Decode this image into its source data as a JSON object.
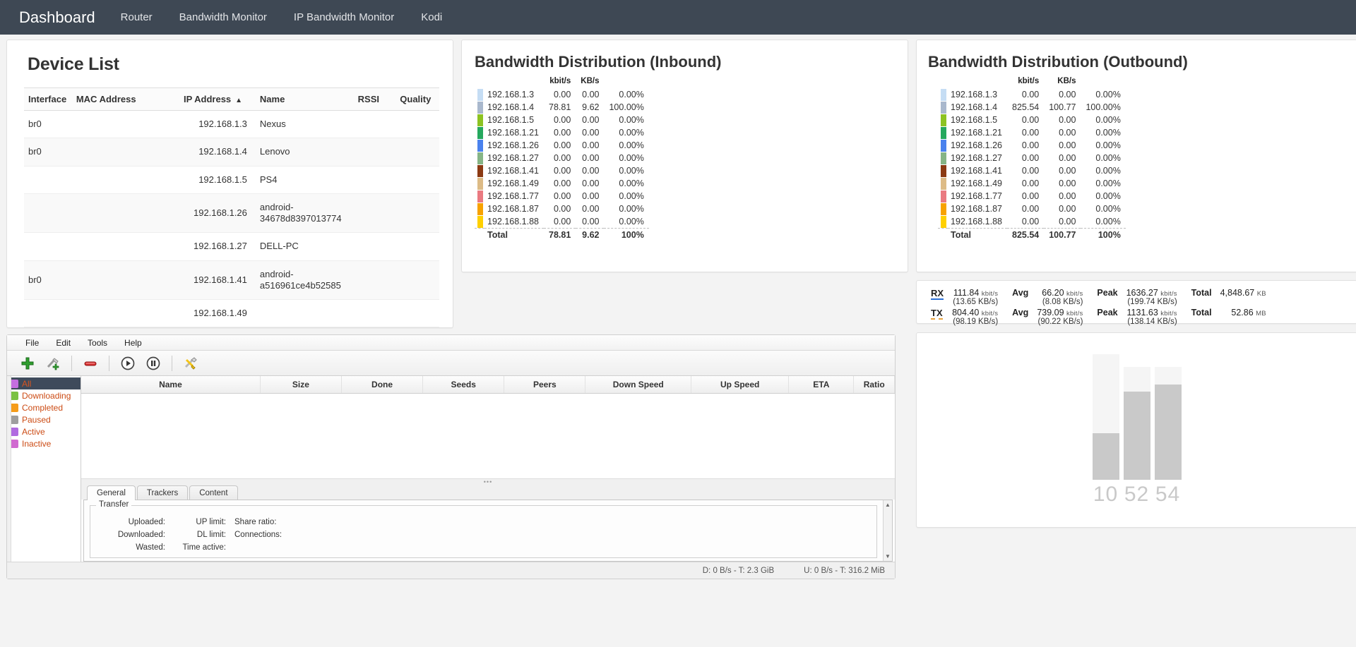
{
  "navbar": {
    "brand": "Dashboard",
    "items": [
      {
        "label": "Router"
      },
      {
        "label": "Bandwidth Monitor"
      },
      {
        "label": "IP Bandwidth Monitor"
      },
      {
        "label": "Kodi"
      }
    ]
  },
  "device_list": {
    "title": "Device List",
    "columns": [
      "Interface",
      "MAC Address",
      "IP Address",
      "Name",
      "RSSI",
      "Quality"
    ],
    "sort_column": "IP Address",
    "sort_arrow": "▲",
    "rows": [
      {
        "interface": "br0",
        "mac": "",
        "ip": "192.168.1.3",
        "name": "Nexus",
        "rssi": "",
        "quality": ""
      },
      {
        "interface": "br0",
        "mac": "",
        "ip": "192.168.1.4",
        "name": "Lenovo",
        "rssi": "",
        "quality": ""
      },
      {
        "interface": "",
        "mac": "",
        "ip": "192.168.1.5",
        "name": "PS4",
        "rssi": "",
        "quality": ""
      },
      {
        "interface": "",
        "mac": "",
        "ip": "192.168.1.26",
        "name": "android-34678d8397013774",
        "rssi": "",
        "quality": ""
      },
      {
        "interface": "",
        "mac": "",
        "ip": "192.168.1.27",
        "name": "DELL-PC",
        "rssi": "",
        "quality": ""
      },
      {
        "interface": "br0",
        "mac": "",
        "ip": "192.168.1.41",
        "name": "android-a516961ce4b52585",
        "rssi": "",
        "quality": ""
      },
      {
        "interface": "",
        "mac": "",
        "ip": "192.168.1.49",
        "name": "",
        "rssi": "",
        "quality": ""
      }
    ]
  },
  "bandwidth_inbound": {
    "title": "Bandwidth Distribution (Inbound)",
    "columns": [
      "kbit/s",
      "KB/s"
    ],
    "total_label": "Total",
    "total_kbits": "78.81",
    "total_kbytes": "9.62",
    "total_percent": "100%",
    "rows": [
      {
        "ip": "192.168.1.3",
        "color": "#c5ddf4",
        "kbits": "0.00",
        "kbytes": "0.00",
        "percent": "0.00%"
      },
      {
        "ip": "192.168.1.4",
        "color": "#a9b8cd",
        "kbits": "78.81",
        "kbytes": "9.62",
        "percent": "100.00%"
      },
      {
        "ip": "192.168.1.5",
        "color": "#8dc322",
        "kbits": "0.00",
        "kbytes": "0.00",
        "percent": "0.00%"
      },
      {
        "ip": "192.168.1.21",
        "color": "#25a85e",
        "kbits": "0.00",
        "kbytes": "0.00",
        "percent": "0.00%"
      },
      {
        "ip": "192.168.1.26",
        "color": "#4a82ee",
        "kbits": "0.00",
        "kbytes": "0.00",
        "percent": "0.00%"
      },
      {
        "ip": "192.168.1.27",
        "color": "#86b586",
        "kbits": "0.00",
        "kbytes": "0.00",
        "percent": "0.00%"
      },
      {
        "ip": "192.168.1.41",
        "color": "#8c3a13",
        "kbits": "0.00",
        "kbytes": "0.00",
        "percent": "0.00%"
      },
      {
        "ip": "192.168.1.49",
        "color": "#ddbb86",
        "kbits": "0.00",
        "kbytes": "0.00",
        "percent": "0.00%"
      },
      {
        "ip": "192.168.1.77",
        "color": "#ea7a81",
        "kbits": "0.00",
        "kbytes": "0.00",
        "percent": "0.00%"
      },
      {
        "ip": "192.168.1.87",
        "color": "#f7a200",
        "kbits": "0.00",
        "kbytes": "0.00",
        "percent": "0.00%"
      },
      {
        "ip": "192.168.1.88",
        "color": "#ffd000",
        "kbits": "0.00",
        "kbytes": "0.00",
        "percent": "0.00%"
      }
    ]
  },
  "bandwidth_outbound": {
    "title": "Bandwidth Distribution (Outbound)",
    "columns": [
      "kbit/s",
      "KB/s"
    ],
    "total_label": "Total",
    "total_kbits": "825.54",
    "total_kbytes": "100.77",
    "total_percent": "100%",
    "rows": [
      {
        "ip": "192.168.1.3",
        "color": "#c5ddf4",
        "kbits": "0.00",
        "kbytes": "0.00",
        "percent": "0.00%"
      },
      {
        "ip": "192.168.1.4",
        "color": "#a9b8cd",
        "kbits": "825.54",
        "kbytes": "100.77",
        "percent": "100.00%"
      },
      {
        "ip": "192.168.1.5",
        "color": "#8dc322",
        "kbits": "0.00",
        "kbytes": "0.00",
        "percent": "0.00%"
      },
      {
        "ip": "192.168.1.21",
        "color": "#25a85e",
        "kbits": "0.00",
        "kbytes": "0.00",
        "percent": "0.00%"
      },
      {
        "ip": "192.168.1.26",
        "color": "#4a82ee",
        "kbits": "0.00",
        "kbytes": "0.00",
        "percent": "0.00%"
      },
      {
        "ip": "192.168.1.27",
        "color": "#86b586",
        "kbits": "0.00",
        "kbytes": "0.00",
        "percent": "0.00%"
      },
      {
        "ip": "192.168.1.41",
        "color": "#8c3a13",
        "kbits": "0.00",
        "kbytes": "0.00",
        "percent": "0.00%"
      },
      {
        "ip": "192.168.1.49",
        "color": "#ddbb86",
        "kbits": "0.00",
        "kbytes": "0.00",
        "percent": "0.00%"
      },
      {
        "ip": "192.168.1.77",
        "color": "#ea7a81",
        "kbits": "0.00",
        "kbytes": "0.00",
        "percent": "0.00%"
      },
      {
        "ip": "192.168.1.87",
        "color": "#f7a200",
        "kbits": "0.00",
        "kbytes": "0.00",
        "percent": "0.00%"
      },
      {
        "ip": "192.168.1.88",
        "color": "#ffd000",
        "kbits": "0.00",
        "kbytes": "0.00",
        "percent": "0.00%"
      }
    ]
  },
  "rxtx": {
    "rx_label": "RX",
    "rx_current": "111.84",
    "rx_current_unit": "kbit/s",
    "rx_current_sub": "(13.65 KB/s)",
    "rx_avg_label": "Avg",
    "rx_avg": "66.20",
    "rx_avg_unit": "kbit/s",
    "rx_avg_sub": "(8.08 KB/s)",
    "rx_peak_label": "Peak",
    "rx_peak": "1636.27",
    "rx_peak_unit": "kbit/s",
    "rx_peak_sub": "(199.74 KB/s)",
    "rx_total_label": "Total",
    "rx_total": "4,848.67",
    "rx_total_unit": "KB",
    "tx_label": "TX",
    "tx_current": "804.40",
    "tx_current_unit": "kbit/s",
    "tx_current_sub": "(98.19 KB/s)",
    "tx_avg_label": "Avg",
    "tx_avg": "739.09",
    "tx_avg_unit": "kbit/s",
    "tx_avg_sub": "(90.22 KB/s)",
    "tx_peak_label": "Peak",
    "tx_peak": "1131.63",
    "tx_peak_unit": "kbit/s",
    "tx_peak_sub": "(138.14 KB/s)",
    "tx_total_label": "Total",
    "tx_total": "52.86",
    "tx_total_unit": "MB"
  },
  "chart_data": {
    "type": "bar",
    "title": "",
    "categories": [
      "10",
      "52",
      "54"
    ],
    "values": [
      10,
      52,
      54
    ],
    "fill_percent": [
      37,
      78,
      84
    ],
    "xlabel": "",
    "ylabel": "",
    "ylim": [
      0,
      64
    ],
    "grid": false,
    "legend": "none",
    "bar_color": "#c9c9c9",
    "track_color": "#f5f5f5",
    "label_color": "#c9c9c9"
  },
  "torrent": {
    "menu": [
      "File",
      "Edit",
      "Tools",
      "Help"
    ],
    "toolbar_icons": [
      "add-torrent-icon",
      "add-torrent-link-icon",
      "remove-torrent-icon",
      "start-torrent-icon",
      "pause-torrent-icon",
      "options-icon"
    ],
    "filters": [
      {
        "label": "All",
        "color": "#c56ee0",
        "selected": true
      },
      {
        "label": "Downloading",
        "color": "#7ac143",
        "selected": false
      },
      {
        "label": "Completed",
        "color": "#f59c1a",
        "selected": false
      },
      {
        "label": "Paused",
        "color": "#9e9e9e",
        "selected": false
      },
      {
        "label": "Active",
        "color": "#b06ae0",
        "selected": false
      },
      {
        "label": "Inactive",
        "color": "#d06ad0",
        "selected": false
      }
    ],
    "grid_columns": [
      "Name",
      "Size",
      "Done",
      "Seeds",
      "Peers",
      "Down Speed",
      "Up Speed",
      "ETA",
      "Ratio"
    ],
    "detail_tabs": [
      {
        "label": "General",
        "active": true
      },
      {
        "label": "Trackers",
        "active": false
      },
      {
        "label": "Content",
        "active": false
      }
    ],
    "transfer_legend": "Transfer",
    "transfer_fields": [
      {
        "left": "Uploaded:",
        "mid": "UP limit:",
        "right": "Share ratio:"
      },
      {
        "left": "Downloaded:",
        "mid": "DL limit:",
        "right": "Connections:"
      },
      {
        "left": "Wasted:",
        "mid": "Time active:",
        "right": ""
      }
    ],
    "status_down": "D: 0 B/s - T: 2.3 GiB",
    "status_up": "U: 0 B/s - T: 316.2 MiB"
  }
}
